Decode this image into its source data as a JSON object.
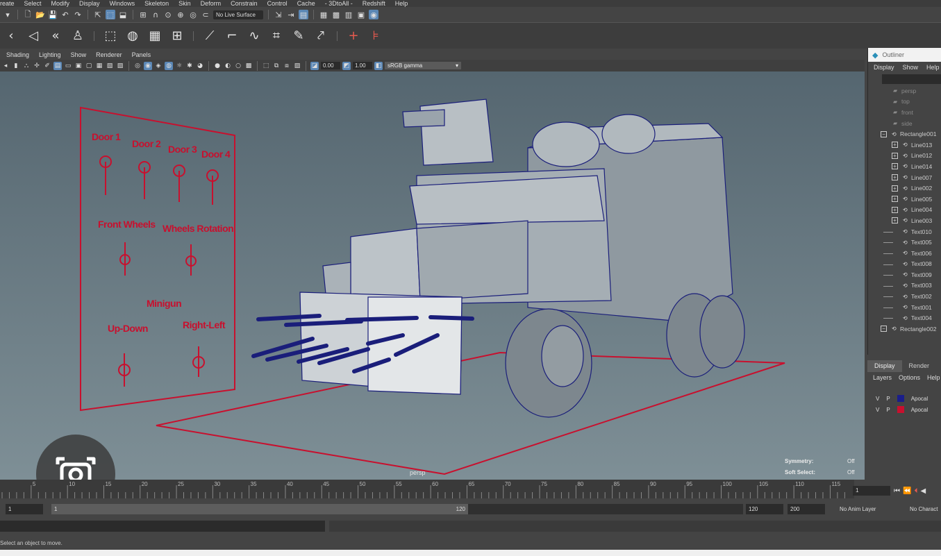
{
  "menu": [
    "reate",
    "Select",
    "Modify",
    "Display",
    "Windows",
    "Skeleton",
    "Skin",
    "Deform",
    "Constrain",
    "Control",
    "Cache",
    "- 3DtoAll -",
    "Redshift",
    "Help"
  ],
  "statusline": {
    "live_surface": "No Live Surface"
  },
  "panel_menu": [
    "Shading",
    "Lighting",
    "Show",
    "Renderer",
    "Panels"
  ],
  "panel_toolbar": {
    "exposure": "0.00",
    "gamma": "1.00",
    "colorspace": "sRGB gamma"
  },
  "viewport": {
    "camera": "persp",
    "controls": {
      "door1": "Door 1",
      "door2": "Door 2",
      "door3": "Door 3",
      "door4": "Door 4",
      "front_wheels": "Front Wheels",
      "wheels_rotation": "Wheels Rotation",
      "minigun": "Minigun",
      "up_down": "Up-Down",
      "right_left": "Right-Left"
    },
    "hud": {
      "symmetry_label": "Symmetry:",
      "symmetry_value": "Off",
      "soft_select_label": "Soft Select:",
      "soft_select_value": "Off"
    },
    "colors": {
      "control_red": "#c8102e",
      "wire_blue": "#1a1e7a"
    }
  },
  "outliner": {
    "title": "Outliner",
    "menu": [
      "Display",
      "Show",
      "Help"
    ],
    "items": [
      {
        "label": "persp",
        "type": "camera",
        "dim": true
      },
      {
        "label": "top",
        "type": "camera",
        "dim": true
      },
      {
        "label": "front",
        "type": "camera",
        "dim": true
      },
      {
        "label": "side",
        "type": "camera",
        "dim": true
      },
      {
        "label": "Rectangle001",
        "type": "group",
        "expand": "minus"
      },
      {
        "label": "Line013",
        "type": "child",
        "expand": "plus"
      },
      {
        "label": "Line012",
        "type": "child",
        "expand": "plus"
      },
      {
        "label": "Line014",
        "type": "child",
        "expand": "plus"
      },
      {
        "label": "Line007",
        "type": "child",
        "expand": "plus"
      },
      {
        "label": "Line002",
        "type": "child",
        "expand": "plus"
      },
      {
        "label": "Line005",
        "type": "child",
        "expand": "plus"
      },
      {
        "label": "Line004",
        "type": "child",
        "expand": "plus"
      },
      {
        "label": "Line003",
        "type": "child",
        "expand": "plus"
      },
      {
        "label": "Text010",
        "type": "leaf"
      },
      {
        "label": "Text005",
        "type": "leaf"
      },
      {
        "label": "Text006",
        "type": "leaf"
      },
      {
        "label": "Text008",
        "type": "leaf"
      },
      {
        "label": "Text009",
        "type": "leaf"
      },
      {
        "label": "Text003",
        "type": "leaf"
      },
      {
        "label": "Text002",
        "type": "leaf"
      },
      {
        "label": "Text001",
        "type": "leaf"
      },
      {
        "label": "Text004",
        "type": "leaf"
      },
      {
        "label": "Rectangle002",
        "type": "group",
        "expand": "minus"
      }
    ]
  },
  "layer_editor": {
    "tabs": [
      "Display",
      "Render"
    ],
    "menu": [
      "Layers",
      "Options",
      "Help"
    ],
    "layers": [
      {
        "v": "V",
        "p": "P",
        "name": "Apocal",
        "color": "#1a1e8a"
      },
      {
        "v": "V",
        "p": "P",
        "name": "Apocal",
        "color": "#c8102e"
      }
    ]
  },
  "timeline": {
    "ticks": [
      "5",
      "10",
      "15",
      "20",
      "25",
      "30",
      "35",
      "40",
      "45",
      "50",
      "55",
      "60",
      "65",
      "70",
      "75",
      "80",
      "85",
      "90",
      "95",
      "100",
      "105",
      "110",
      "115",
      "120"
    ],
    "current_frame": "1"
  },
  "range": {
    "start": "1",
    "slider_start": "1",
    "slider_end": "120",
    "end": "120",
    "max": "200",
    "anim_layer": "No Anim Layer",
    "character": "No Charact"
  },
  "helpline": "Select an object to move."
}
